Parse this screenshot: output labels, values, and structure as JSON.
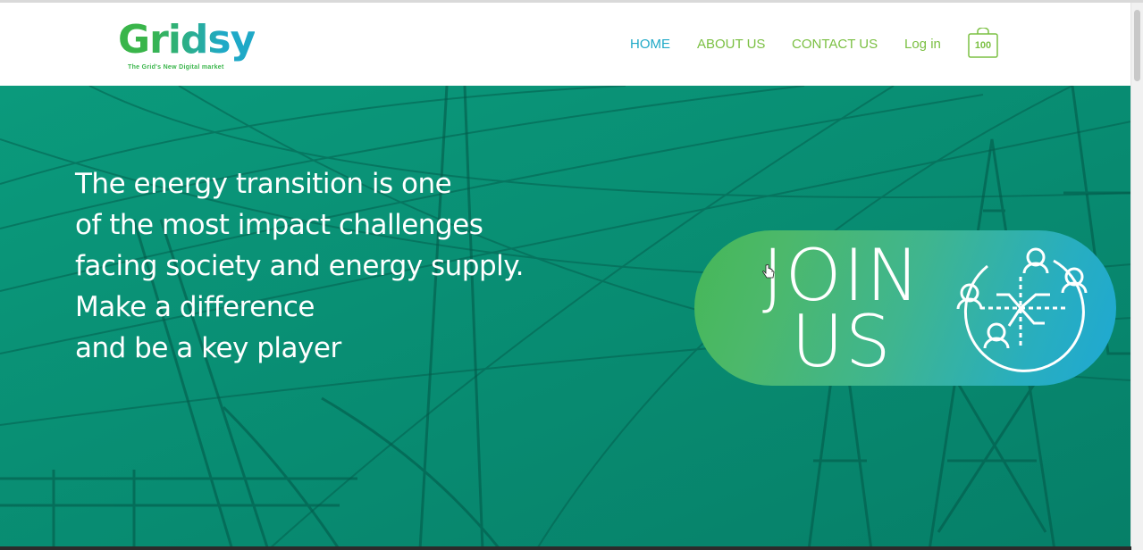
{
  "brand": {
    "logo_text_first": "G",
    "logo_text_rest": "ridsy",
    "tagline": "The Grid's New Digital market",
    "green": "#39b54a",
    "blue": "#1fa9c7"
  },
  "nav": {
    "items": [
      {
        "label": "HOME",
        "active": true
      },
      {
        "label": "ABOUT US"
      },
      {
        "label": "CONTACT US"
      },
      {
        "label": "Log in"
      }
    ],
    "cart_count": "100",
    "cart_icon": "shopping-bag-icon"
  },
  "hero": {
    "lines": [
      "The energy transition is one",
      "of the most impact challenges",
      "facing society and energy supply.",
      "Make a difference",
      "and be a key player"
    ],
    "background_color": "#089478"
  },
  "cta": {
    "line1": "JOIN",
    "line2": "US",
    "icon": "network-people-globe-icon"
  }
}
